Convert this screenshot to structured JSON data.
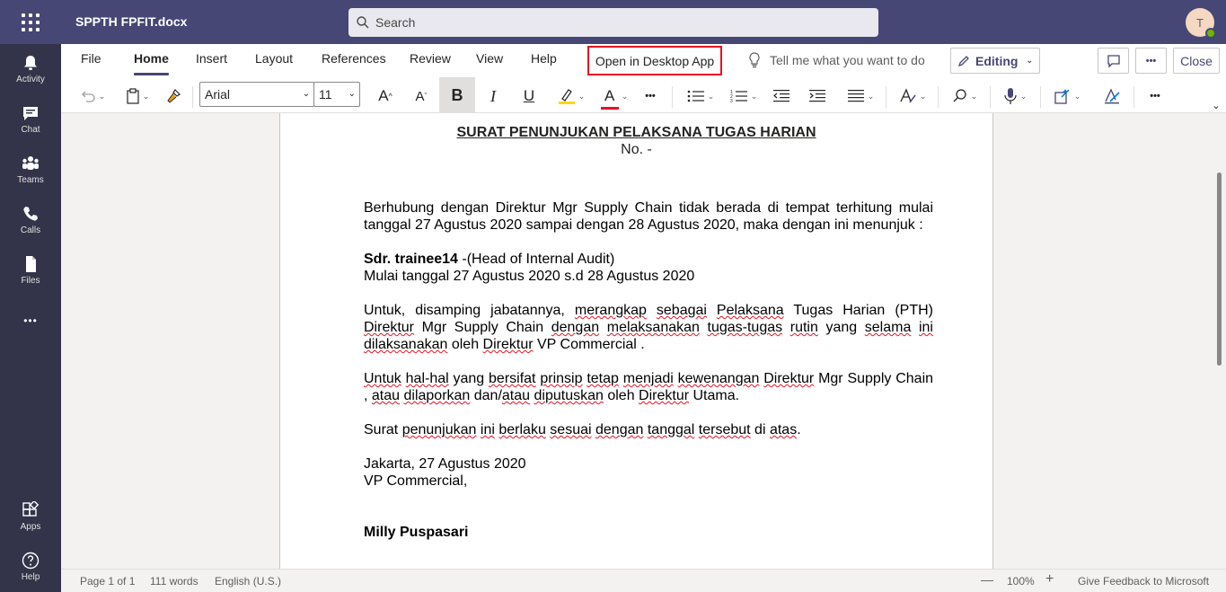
{
  "titlebar": {
    "doc_title": "SPPTH FPFIT.docx",
    "search_placeholder": "Search",
    "avatar_initial": "T"
  },
  "rail": {
    "items": [
      {
        "label": "Activity",
        "icon": "bell-icon"
      },
      {
        "label": "Chat",
        "icon": "chat-icon"
      },
      {
        "label": "Teams",
        "icon": "teams-icon"
      },
      {
        "label": "Calls",
        "icon": "phone-icon"
      },
      {
        "label": "Files",
        "icon": "file-icon"
      }
    ],
    "more": "•••",
    "apps_label": "Apps",
    "help_label": "Help"
  },
  "ribbon": {
    "tabs": [
      "File",
      "Home",
      "Insert",
      "Layout",
      "References",
      "Review",
      "View",
      "Help"
    ],
    "active_tab": "Home",
    "open_desktop": "Open in Desktop App",
    "tell_me": "Tell me what you want to do",
    "editing": "Editing",
    "more": "•••",
    "close": "Close",
    "font_name": "Arial",
    "font_size": "11",
    "bold": "B",
    "italic": "I",
    "underline": "U",
    "font_color_letter": "A",
    "grow_font": "A",
    "shrink_font": "A",
    "ellipsis": "•••",
    "highlight_color": "#ffd900",
    "font_color": "#e81123"
  },
  "document": {
    "title": "SURAT PENUNJUKAN PELAKSANA TUGAS HARIAN",
    "number": "No. -",
    "p1": "Berhubung dengan Direktur Mgr Supply Chain tidak berada di tempat terhitung mulai tanggal 27 Agustus 2020 sampai dengan 28 Agustus 2020, maka dengan ini menunjuk :",
    "appointee_name": "Sdr. trainee14",
    "appointee_role": " -(Head of Internal Audit)",
    "p2": "Mulai tanggal 27 Agustus 2020 s.d 28 Agustus 2020",
    "p3_a": "Untuk, disamping jabatannya, ",
    "p3_b": "merangkap",
    "p3_c": " ",
    "p3_d": "sebagai",
    "p3_e": " ",
    "p3_f": "Pelaksana",
    "p3_g": " Tugas Harian (PTH) ",
    "p3_h": "Direktur",
    "p3_i": " Mgr Supply Chain ",
    "p3_j": "dengan",
    "p3_k": " ",
    "p3_l": "melaksanakan",
    "p3_m": " ",
    "p3_n": "tugas-tugas",
    "p3_o": " ",
    "p3_p": "rutin",
    "p3_q": " yang ",
    "p3_r": "selama",
    "p3_s": " ",
    "p3_t": "ini",
    "p3_u": " ",
    "p3_v": "dilaksanakan",
    "p3_w": " oleh ",
    "p3_x": "Direktur",
    "p3_y": " VP Commercial .",
    "p4_a": "Untuk",
    "p4_b": " ",
    "p4_c": "hal-hal",
    "p4_d": " yang ",
    "p4_e": "bersifat",
    "p4_f": " ",
    "p4_g": "prinsip",
    "p4_h": " ",
    "p4_i": "tetap",
    "p4_j": " ",
    "p4_k": "menjadi",
    "p4_l": " ",
    "p4_m": "kewenangan",
    "p4_n": " ",
    "p4_o": "Direktur",
    "p4_p": " Mgr Supply Chain , ",
    "p4_q": "atau",
    "p4_r": " ",
    "p4_s": "dilaporkan",
    "p4_t": " dan/",
    "p4_u": "atau",
    "p4_v": " ",
    "p4_w": "diputuskan",
    "p4_x": " oleh ",
    "p4_y": "Direktur",
    "p4_z": " Utama.",
    "p5_a": "Surat ",
    "p5_b": "penunjukan",
    "p5_c": " ",
    "p5_d": "ini",
    "p5_e": " ",
    "p5_f": "berlaku",
    "p5_g": " ",
    "p5_h": "sesuai",
    "p5_i": " ",
    "p5_j": "dengan",
    "p5_k": " ",
    "p5_l": "tanggal",
    "p5_m": " ",
    "p5_n": "tersebut",
    "p5_o": " di ",
    "p5_p": "atas",
    "p5_q": ".",
    "place_date": "Jakarta, 27 Agustus 2020",
    "signer_title": "VP Commercial,",
    "signer_name": "Milly Puspasari"
  },
  "status": {
    "page": "Page 1 of 1",
    "words": "111 words",
    "language": "English (U.S.)",
    "zoom_out": "—",
    "zoom": "100%",
    "zoom_in": "+",
    "feedback": "Give Feedback to Microsoft"
  }
}
